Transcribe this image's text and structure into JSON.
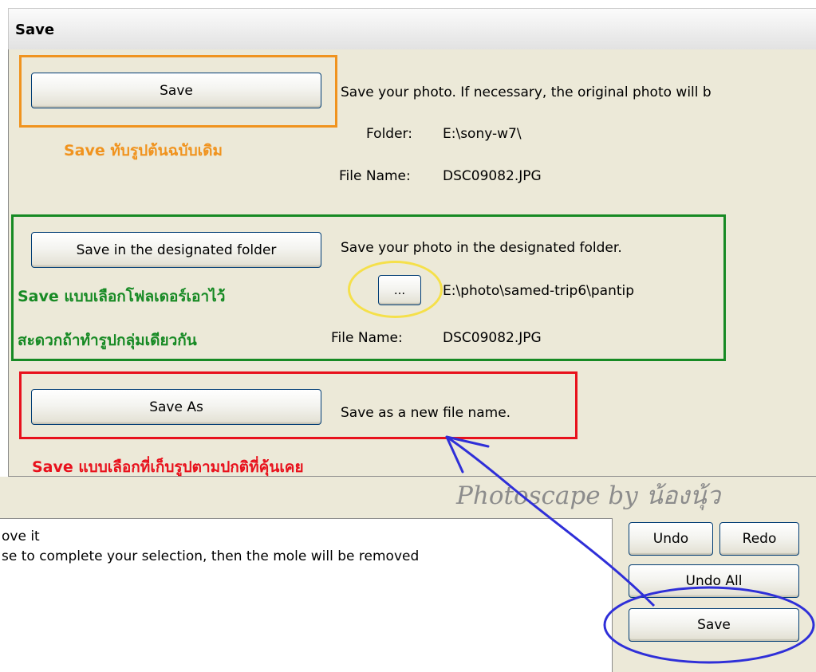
{
  "window": {
    "title": "Save"
  },
  "save_section": {
    "button_label": "Save",
    "description": "Save your photo. If necessary, the original photo will b",
    "folder_label": "Folder:",
    "folder_value": "E:\\sony-w7\\",
    "filename_label": "File Name:",
    "filename_value": "DSC09082.JPG",
    "annotation": "Save ทับรูปต้นฉบับเดิม"
  },
  "designated_section": {
    "button_label": "Save in the designated folder",
    "description": "Save your photo in the designated folder.",
    "browse_label": "...",
    "folder_value": "E:\\photo\\samed-trip6\\pantip",
    "filename_label": "File Name:",
    "filename_value": "DSC09082.JPG",
    "annotation_line1": "Save แบบเลือกโฟลเดอร์เอาไว้",
    "annotation_line2": "สะดวกถ้าทำรูปกลุ่มเดียวกัน"
  },
  "saveas_section": {
    "button_label": "Save As",
    "description": "Save as a new file name.",
    "annotation": "Save แบบเลือกที่เก็บรูปตามปกติที่คุ้นเคย"
  },
  "info_panel": {
    "line1": "ove it",
    "line2": "se to complete your selection, then the mole will be removed"
  },
  "editor_buttons": {
    "undo": "Undo",
    "redo": "Redo",
    "undo_all": "Undo All",
    "save": "Save"
  },
  "watermark": "Photoscape by น้องนุ้ว",
  "colors": {
    "orange": "#f0931e",
    "green": "#178a24",
    "red": "#e8111c",
    "yellow": "#f5e04a",
    "blue": "#2f2fd8"
  }
}
